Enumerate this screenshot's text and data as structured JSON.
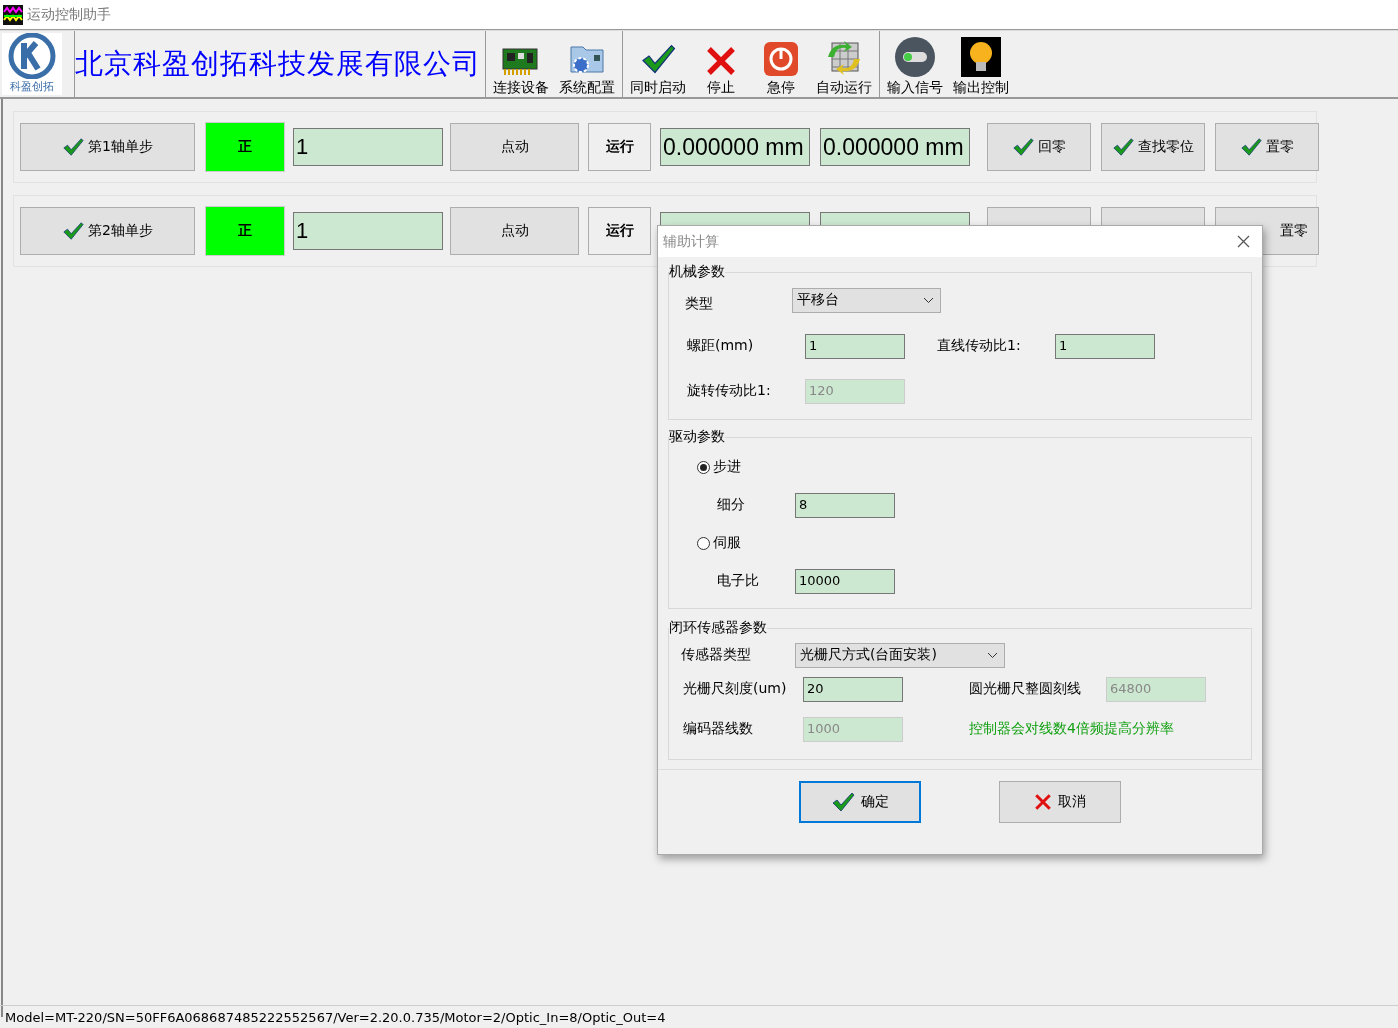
{
  "window": {
    "title": "运动控制助手"
  },
  "toolbar": {
    "logo_text": "科盈创拓",
    "company": "北京科盈创拓科技发展有限公司",
    "groups": [
      [
        {
          "label": "连接设备",
          "kind": "board"
        },
        {
          "label": "系统配置",
          "kind": "config"
        }
      ],
      [
        {
          "label": "同时启动",
          "kind": "check"
        },
        {
          "label": "停止",
          "kind": "cross"
        },
        {
          "label": "急停",
          "kind": "power"
        },
        {
          "label": "自动运行",
          "kind": "cycle"
        }
      ],
      [
        {
          "label": "输入信号",
          "kind": "toggle"
        },
        {
          "label": "输出控制",
          "kind": "bulb"
        }
      ]
    ]
  },
  "axes": [
    {
      "axis_button": "第1轴单步",
      "direction": "正",
      "step": "1",
      "jog": "点动",
      "run": "运行",
      "position": "0.000000 mm",
      "encoder": "0.000000 mm",
      "home": "回零",
      "find_zero": "查找零位",
      "set_zero": "置零"
    },
    {
      "axis_button": "第2轴单步",
      "direction": "正",
      "step": "1",
      "jog": "点动",
      "run": "运行",
      "set_zero": "置零"
    }
  ],
  "dialog": {
    "title": "辅助计算",
    "mechanical": {
      "legend": "机械参数",
      "type_label": "类型",
      "type_value": "平移台",
      "pitch_label": "螺距(mm)",
      "pitch": {
        "value": "1",
        "disabled": false
      },
      "linear_label": "直线传动比1:",
      "linear": {
        "value": "1",
        "disabled": false
      },
      "rotary_label": "旋转传动比1:",
      "rotary": {
        "value": "120",
        "disabled": true
      }
    },
    "drive": {
      "legend": "驱动参数",
      "modes": [
        {
          "label": "步进",
          "selected": true,
          "field_label": "细分",
          "field": {
            "value": "8",
            "disabled": false
          }
        },
        {
          "label": "伺服",
          "selected": false,
          "field_label": "电子比",
          "field": {
            "value": "10000",
            "disabled": false
          }
        }
      ]
    },
    "sensor": {
      "legend": "闭环传感器参数",
      "type_label": "传感器类型",
      "type_value": "光栅尺方式(台面安装)",
      "scale_label": "光栅尺刻度(um)",
      "scale": {
        "value": "20",
        "disabled": false
      },
      "circle_label": "圆光栅尺整圆刻线",
      "circle": {
        "value": "64800",
        "disabled": true
      },
      "encoder_label": "编码器线数",
      "encoder": {
        "value": "1000",
        "disabled": true
      },
      "note": "控制器会对线数4倍频提高分辨率"
    },
    "buttons": [
      {
        "label": "确定",
        "kind": "ok",
        "focused": true
      },
      {
        "label": "取消",
        "kind": "cancel",
        "focused": false
      }
    ]
  },
  "status_bar": "Model=MT-220/SN=50FF6A068687485222552567/Ver=2.20.0.735/Motor=2/Optic_In=8/Optic_Out=4"
}
